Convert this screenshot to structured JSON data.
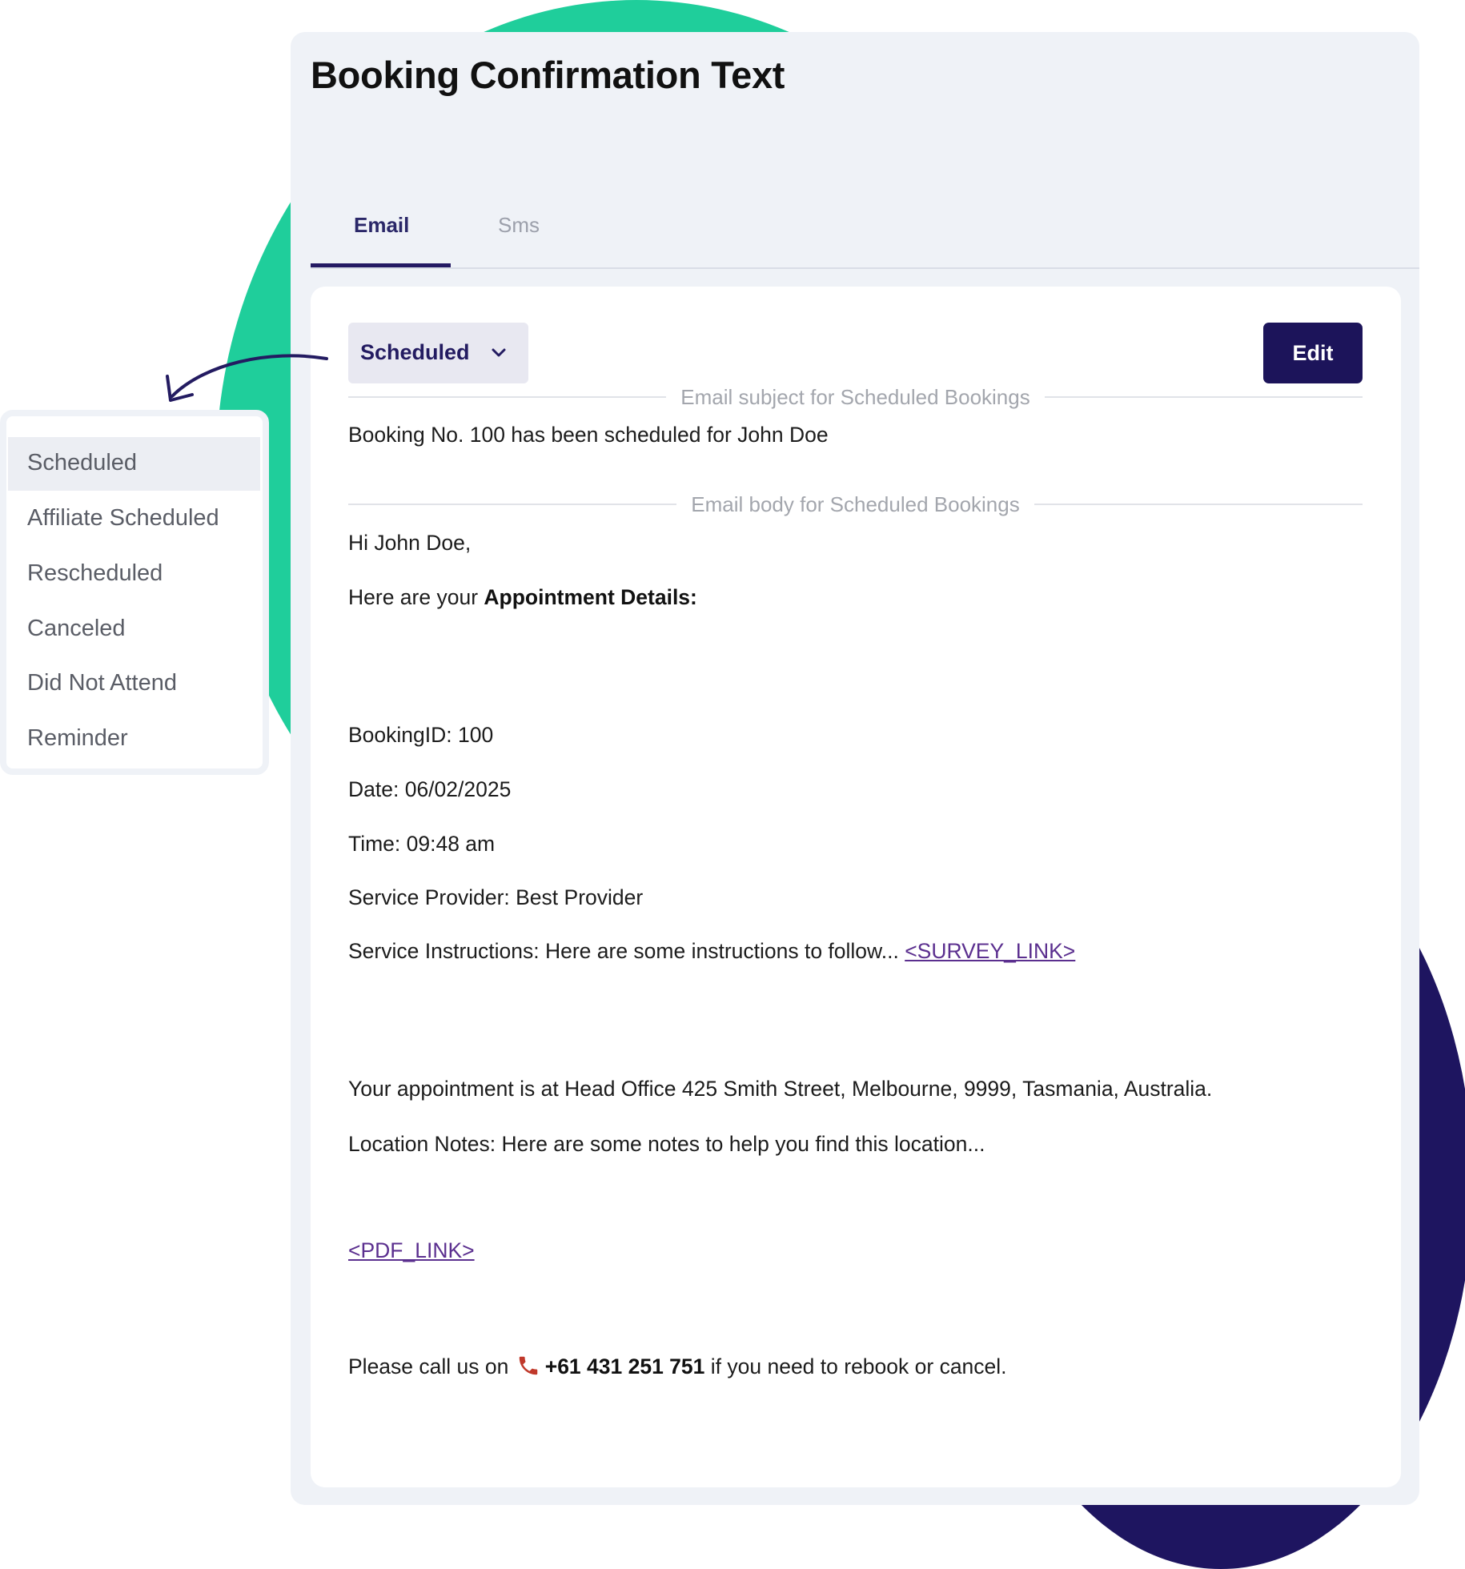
{
  "page": {
    "title": "Booking Confirmation Text",
    "colors": {
      "accent_green": "#1fce9b",
      "navy": "#1e1560",
      "panel_bg": "#eff2f7"
    }
  },
  "tabs": [
    {
      "label": "Email",
      "active": true
    },
    {
      "label": "Sms",
      "active": false
    }
  ],
  "toolbar": {
    "status_select_value": "Scheduled",
    "status_select_icon": "chevron-down-icon",
    "edit_label": "Edit"
  },
  "email": {
    "subject_caption": "Email subject for Scheduled Bookings",
    "subject": "Booking No. 100 has been scheduled for John Doe",
    "body_caption": "Email body for Scheduled Bookings",
    "greeting": "Hi John Doe,",
    "details_intro": "Here are your ",
    "details_intro_bold": "Appointment Details:",
    "booking_id": "BookingID: 100",
    "date": "Date: 06/02/2025",
    "time": "Time: 09:48 am",
    "provider": "Service Provider: Best Provider",
    "instructions": "Service Instructions: Here are some instructions to follow... ",
    "survey_link": "<SURVEY_LINK>",
    "location": "Your appointment is at Head Office 425 Smith Street, Melbourne, 9999, Tasmania, Australia.",
    "location_notes": "Location Notes: Here are some notes to help you find this location...",
    "pdf_link": "<PDF_LINK>",
    "call_prefix": "Please call us on ",
    "phone_icon": "phone-icon",
    "phone": "+61 431 251 751",
    "call_suffix": " if you need to rebook or cancel."
  },
  "dropdown": {
    "items": [
      {
        "label": "Scheduled",
        "selected": true
      },
      {
        "label": "Affiliate Scheduled",
        "selected": false
      },
      {
        "label": "Rescheduled",
        "selected": false
      },
      {
        "label": "Canceled",
        "selected": false
      },
      {
        "label": "Did Not Attend",
        "selected": false
      },
      {
        "label": "Reminder",
        "selected": false
      }
    ]
  }
}
